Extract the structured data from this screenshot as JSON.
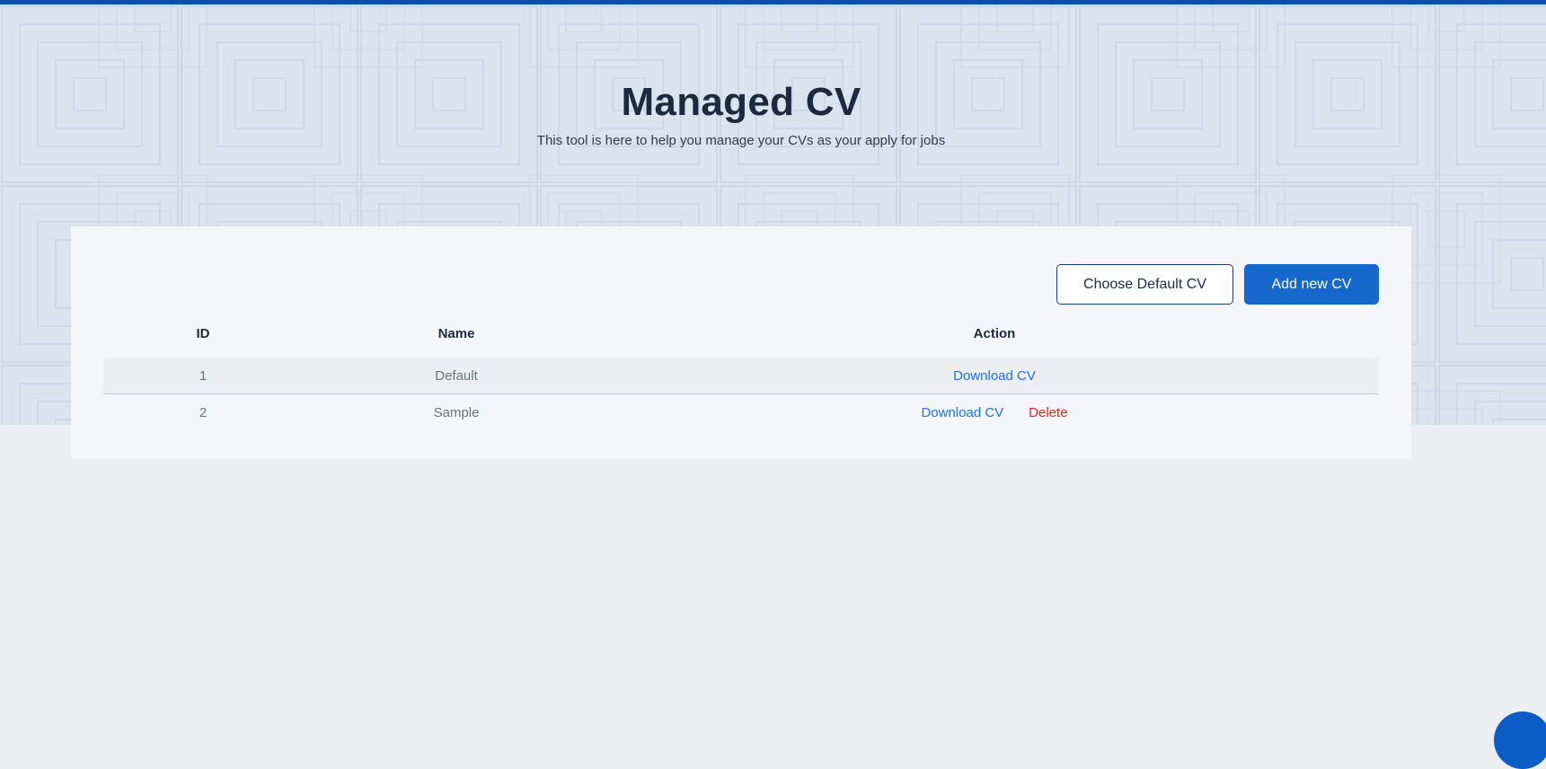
{
  "header": {
    "title": "Managed CV",
    "subtitle": "This tool is here to help you manage your CVs as your apply for jobs"
  },
  "actions": {
    "choose_default_label": "Choose Default CV",
    "add_new_label": "Add new CV"
  },
  "table": {
    "columns": [
      "ID",
      "Name",
      "Action"
    ],
    "rows": [
      {
        "id": "1",
        "name": "Default",
        "download_label": "Download CV"
      },
      {
        "id": "2",
        "name": "Sample",
        "download_label": "Download CV",
        "delete_label": "Delete"
      }
    ]
  },
  "colors": {
    "brand": "#0b4fa8",
    "primary_button": "#1668cc",
    "link": "#1a73e8",
    "danger": "#e02424"
  }
}
